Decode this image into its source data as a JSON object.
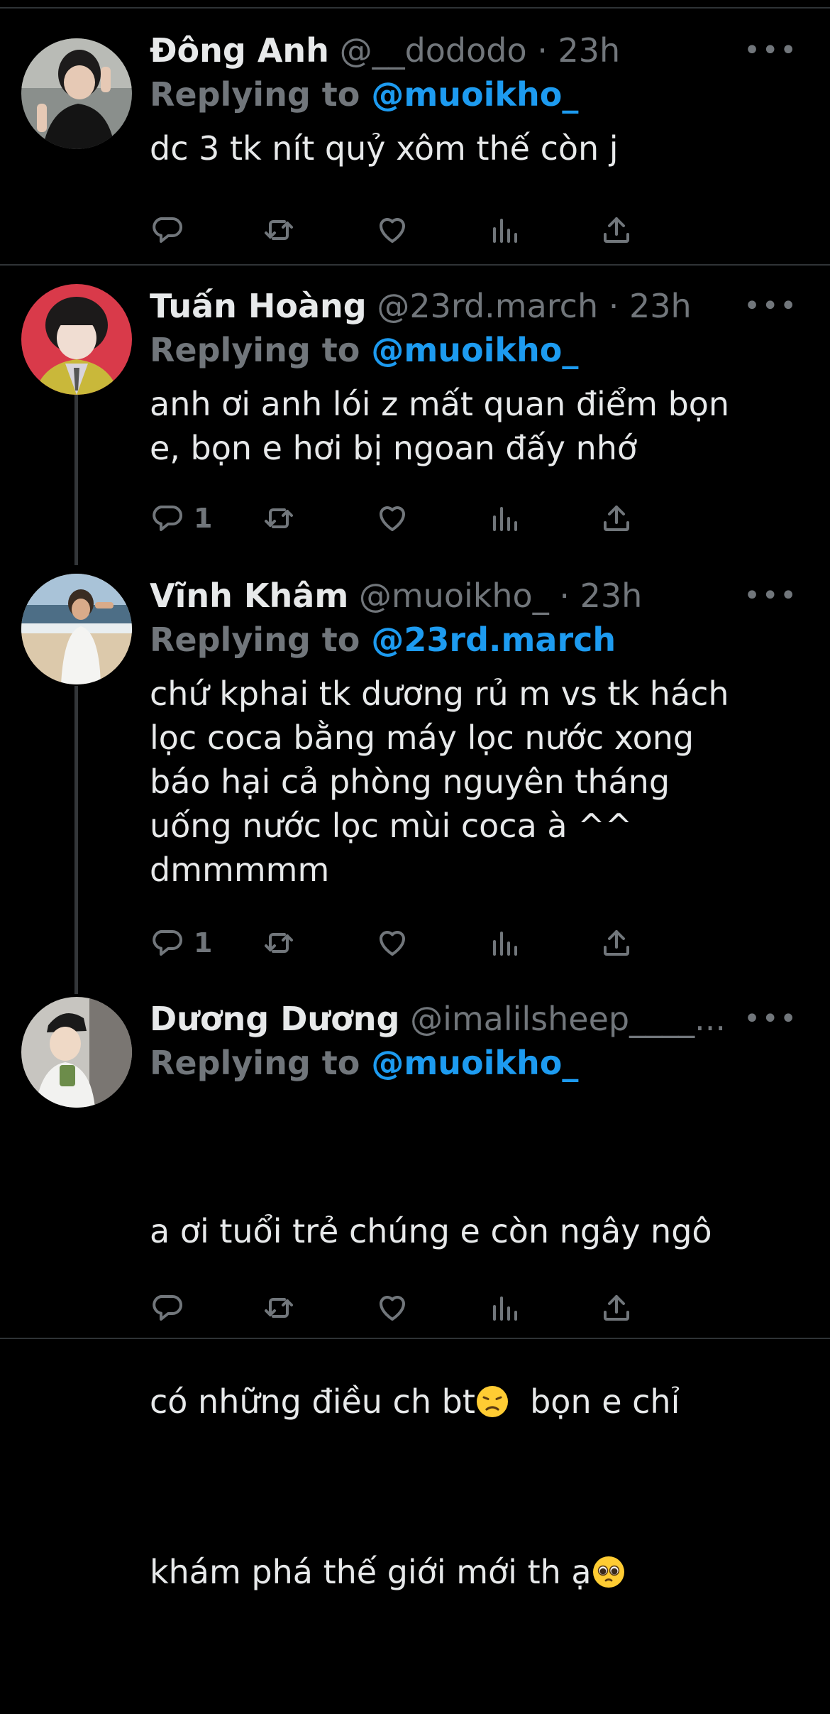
{
  "tweets": [
    {
      "name": "Đông Anh",
      "handle": "@__dododo",
      "time": "· 23h",
      "replying_prefix": "Replying to ",
      "replying_to": "@muoikho_",
      "text": "dc 3 tk nít quỷ xôm thế còn j",
      "reply_count": ""
    },
    {
      "name": "Tuấn Hoàng",
      "handle": "@23rd.march",
      "time": "· 23h",
      "replying_prefix": "Replying to ",
      "replying_to": "@muoikho_",
      "text": "anh ơi anh lói z mất quan điểm bọn\ne, bọn e hơi bị ngoan đấy nhớ",
      "reply_count": "1"
    },
    {
      "name": "Vĩnh Khâm",
      "handle": "@muoikho_",
      "time": "· 23h",
      "replying_prefix": "Replying to ",
      "replying_to": "@23rd.march",
      "text": "chứ kphai tk dương rủ m vs tk hách\nlọc coca bằng máy lọc nước xong\nbáo hại cả phòng nguyên tháng\nuống nước lọc mùi coca à ^^\ndmmmmm",
      "reply_count": "1"
    },
    {
      "name": "Dương Dương",
      "handle": "@imalilsheep____...",
      "time": "",
      "replying_prefix": "Replying to ",
      "replying_to": "@muoikho_",
      "text_line1": "a ơi tuổi trẻ chúng e còn ngây ngô",
      "text_line2a": "có những điều ch bt",
      "text_line2b": "  bọn e chỉ",
      "text_line3": "khám phá thế giới mới th ạ",
      "emoji1": "disappointed-face",
      "emoji2": "pleading-face",
      "reply_count": ""
    }
  ],
  "more_glyph": "•••",
  "icons": [
    "reply-icon",
    "retweet-icon",
    "like-icon",
    "views-icon",
    "share-icon"
  ],
  "colors": {
    "background": "#000000",
    "text": "#e7e9ea",
    "muted": "#71767b",
    "link": "#1d9bf0",
    "divider": "#2f3336"
  }
}
